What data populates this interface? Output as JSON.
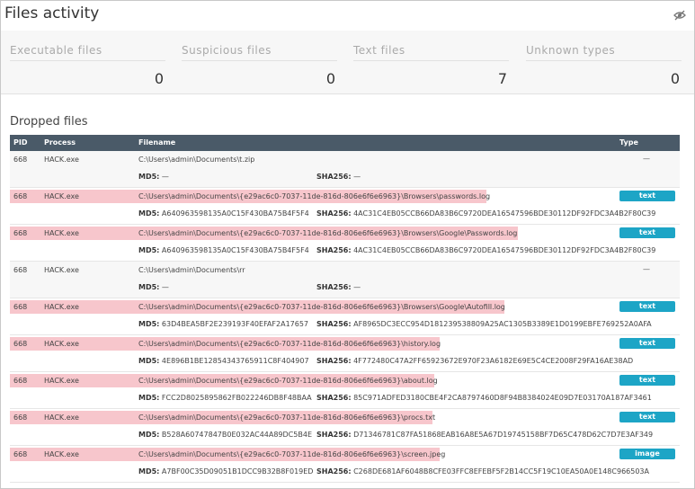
{
  "header": {
    "title": "Files activity"
  },
  "stats": [
    {
      "label": "Executable files",
      "value": "0"
    },
    {
      "label": "Suspicious files",
      "value": "0"
    },
    {
      "label": "Text files",
      "value": "7"
    },
    {
      "label": "Unknown types",
      "value": "0"
    }
  ],
  "section_title": "Dropped files",
  "columns": {
    "pid": "PID",
    "process": "Process",
    "filename": "Filename",
    "type": "Type"
  },
  "hash_labels": {
    "md5": "MD5:",
    "sha256": "SHA256:"
  },
  "rows": [
    {
      "pid": "668",
      "process": "HACK.exe",
      "filename": "C:\\Users\\admin\\Documents\\t.zip",
      "type": "—",
      "md5": "—",
      "sha256": "—",
      "highlight": false
    },
    {
      "pid": "668",
      "process": "HACK.exe",
      "filename": "C:\\Users\\admin\\Documents\\{e29ac6c0-7037-11de-816d-806e6f6e6963}\\Browsers\\passwords.log",
      "type": "text",
      "md5": "A640963598135A0C15F430BA75B4F5F4",
      "sha256": "4AC31C4EB05CCB66DA83B6C9720DEA16547596BDE30112DF92FDC3A4B2F80C39",
      "highlight": true
    },
    {
      "pid": "668",
      "process": "HACK.exe",
      "filename": "C:\\Users\\admin\\Documents\\{e29ac6c0-7037-11de-816d-806e6f6e6963}\\Browsers\\Google\\Passwords.log",
      "type": "text",
      "md5": "A640963598135A0C15F430BA75B4F5F4",
      "sha256": "4AC31C4EB05CCB66DA83B6C9720DEA16547596BDE30112DF92FDC3A4B2F80C39",
      "highlight": true
    },
    {
      "pid": "668",
      "process": "HACK.exe",
      "filename": "C:\\Users\\admin\\Documents\\rr",
      "type": "—",
      "md5": "—",
      "sha256": "—",
      "highlight": false
    },
    {
      "pid": "668",
      "process": "HACK.exe",
      "filename": "C:\\Users\\admin\\Documents\\{e29ac6c0-7037-11de-816d-806e6f6e6963}\\Browsers\\Google\\Autofill.log",
      "type": "text",
      "md5": "63D4BEA5BF2E239193F40EFAF2A17657",
      "sha256": "AF8965DC3ECC954D181239538809A25AC1305B3389E1D0199EBFE769252A0AFA",
      "highlight": true
    },
    {
      "pid": "668",
      "process": "HACK.exe",
      "filename": "C:\\Users\\admin\\Documents\\{e29ac6c0-7037-11de-816d-806e6f6e6963}\\history.log",
      "type": "text",
      "md5": "4E896B1BE12854343765911C8F404907",
      "sha256": "4F772480C47A2FF65923672E970F23A6182E69E5C4CE2008F29FA16AE38AD",
      "highlight": true
    },
    {
      "pid": "668",
      "process": "HACK.exe",
      "filename": "C:\\Users\\admin\\Documents\\{e29ac6c0-7037-11de-816d-806e6f6e6963}\\about.log",
      "type": "text",
      "md5": "FCC2D8025895862FB022246DB8F48BAA",
      "sha256": "85C971ADFED3180CBE4F2CA8797460D8F94B8384024E09D7E03170A187AF3461",
      "highlight": true
    },
    {
      "pid": "668",
      "process": "HACK.exe",
      "filename": "C:\\Users\\admin\\Documents\\{e29ac6c0-7037-11de-816d-806e6f6e6963}\\procs.txt",
      "type": "text",
      "md5": "B528A60747847B0E032AC44A89DC5B4E",
      "sha256": "D71346781C87FA51868EAB16A8E5A67D19745158BF7D65C478D62C7D7E3AF349",
      "highlight": true
    },
    {
      "pid": "668",
      "process": "HACK.exe",
      "filename": "C:\\Users\\admin\\Documents\\{e29ac6c0-7037-11de-816d-806e6f6e6963}\\screen.jpeg",
      "type": "image",
      "md5": "A7BF00C35D09051B1DCC9B32B8F019ED",
      "sha256": "C268DE681AF6048B8CFE03FFC8EFEBF5F2B14CC5F19C10EA50A0E148C966503A",
      "highlight": true
    }
  ]
}
